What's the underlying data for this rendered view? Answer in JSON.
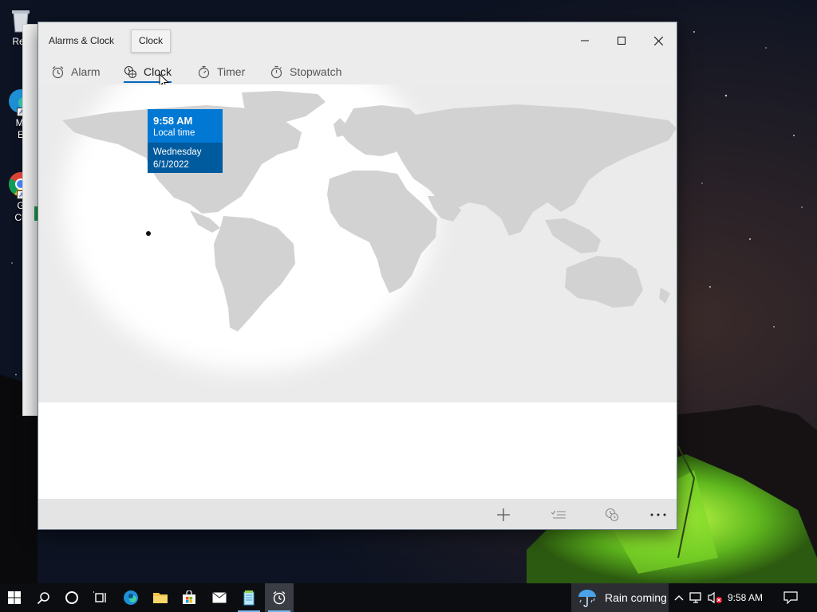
{
  "desktop": {
    "icons": [
      {
        "label": "Rec"
      },
      {
        "label": "Mi"
      },
      {
        "label": "E"
      },
      {
        "label": "G"
      },
      {
        "label": "Ch"
      }
    ]
  },
  "window": {
    "title": "Alarms & Clock",
    "tooltip": "Clock",
    "caption_buttons": [
      "minimize",
      "maximize",
      "close"
    ]
  },
  "tabs": [
    {
      "label": "Alarm",
      "icon": "alarm-clock-icon",
      "active": false
    },
    {
      "label": "Clock",
      "icon": "world-clock-icon",
      "active": true
    },
    {
      "label": "Timer",
      "icon": "timer-icon",
      "active": false
    },
    {
      "label": "Stopwatch",
      "icon": "stopwatch-icon",
      "active": false
    }
  ],
  "time_card": {
    "time": "9:58 AM",
    "subtitle": "Local time",
    "day": "Wednesday",
    "date": "6/1/2022"
  },
  "command_bar": {
    "buttons": [
      "add-icon",
      "edit-list-icon",
      "compare-time-icon",
      "more-icon"
    ]
  },
  "taskbar": {
    "weather": "Rain coming",
    "clock": "9:58 AM",
    "buttons": [
      "windows-start",
      "search",
      "cortana",
      "task-view",
      "edge",
      "file-explorer",
      "store",
      "mail",
      "notepad",
      "alarms-clock"
    ]
  },
  "colors": {
    "accent": "#0078d4",
    "accent_dark": "#005a9e",
    "land": "#d2d2d2",
    "night": "#ebebeb"
  }
}
